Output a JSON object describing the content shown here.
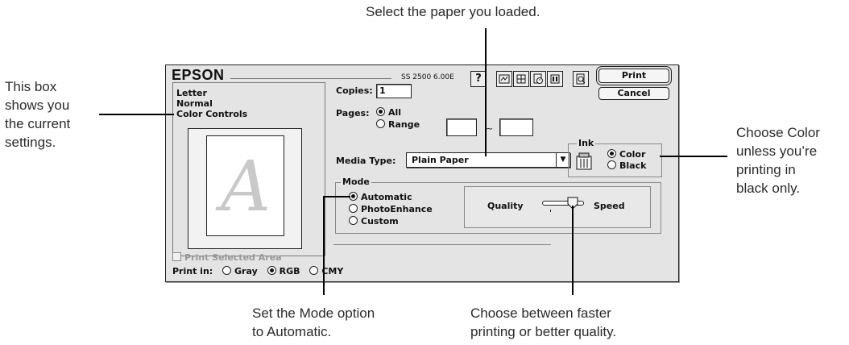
{
  "callouts": {
    "top": "Select the paper you loaded.",
    "left": [
      "This box",
      "shows you",
      "the current",
      "settings."
    ],
    "right": [
      "Choose Color",
      "unless you’re",
      "printing in",
      "black only."
    ],
    "bottom_left": [
      "Set the Mode option",
      "to Automatic."
    ],
    "bottom_right": [
      "Choose between faster",
      "printing or better quality."
    ]
  },
  "dialog": {
    "brand": "EPSON",
    "version": "SS 2500 6.00E",
    "toolbar": {
      "help": "?",
      "icons": [
        "status-monitor-icon",
        "page-setup-icon",
        "background-print-icon",
        "utility-icon",
        "print-preview-icon"
      ]
    },
    "buttons": {
      "print": "Print",
      "cancel": "Cancel"
    },
    "summary": [
      "Letter",
      "Normal",
      "Color Controls"
    ],
    "preview_letter": "A",
    "copies": {
      "label": "Copies:",
      "value": "1"
    },
    "pages": {
      "label": "Pages:",
      "all": "All",
      "range": "Range",
      "separator": "~",
      "from": "",
      "to": ""
    },
    "media_type": {
      "label": "Media Type:",
      "value": "Plain Paper"
    },
    "ink": {
      "label": "Ink",
      "color": "Color",
      "black": "Black",
      "selected": "Color"
    },
    "mode": {
      "label": "Mode",
      "options": [
        "Automatic",
        "PhotoEnhance",
        "Custom"
      ],
      "selected": "Automatic"
    },
    "quality_slider": {
      "left_label": "Quality",
      "right_label": "Speed",
      "position": 0.7
    },
    "print_selected_area": {
      "label": "Print Selected Area",
      "checked": false,
      "enabled": false
    },
    "print_in": {
      "label": "Print in:",
      "options": [
        "Gray",
        "RGB",
        "CMY"
      ],
      "selected": "RGB"
    }
  }
}
